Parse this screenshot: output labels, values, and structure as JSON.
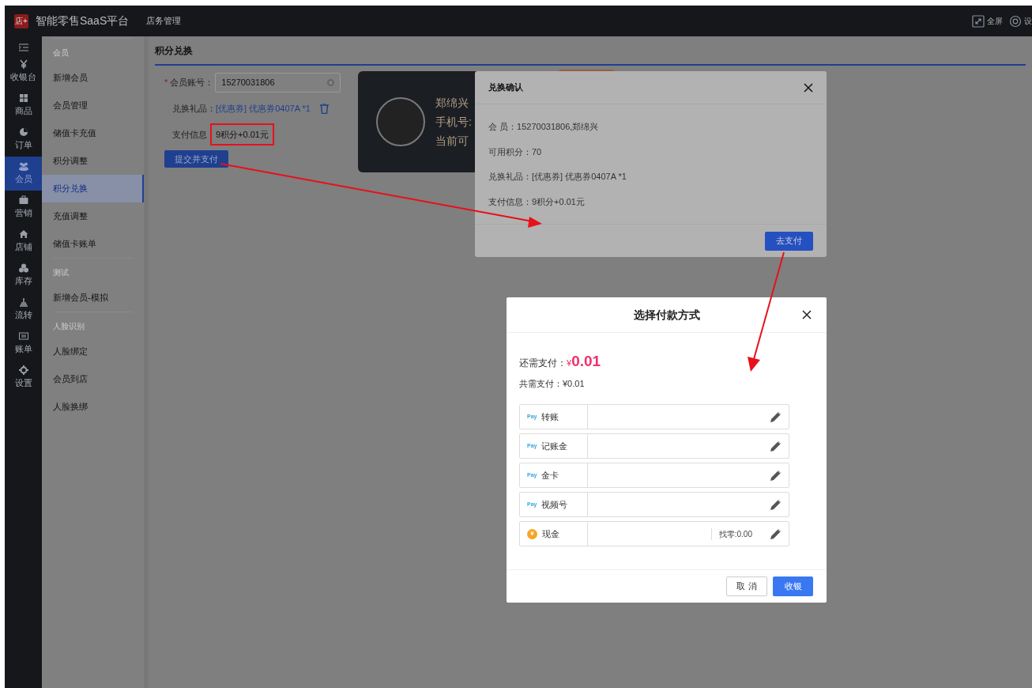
{
  "top_bar": {
    "logo": "店+",
    "title": "智能零售SaaS平台",
    "nav": "店务管理",
    "actions": [
      {
        "kind": "fullscreen",
        "label": "全屏"
      },
      {
        "kind": "settings",
        "label": "设"
      }
    ]
  },
  "icon_nav": [
    {
      "kind": "yen",
      "label": "收银台",
      "selected": false
    },
    {
      "kind": "grid",
      "label": "商品",
      "selected": false
    },
    {
      "kind": "pie",
      "label": "订单",
      "selected": false
    },
    {
      "kind": "users",
      "label": "会员",
      "selected": true
    },
    {
      "kind": "briefcase",
      "label": "营销",
      "selected": false
    },
    {
      "kind": "home",
      "label": "店铺",
      "selected": false
    },
    {
      "kind": "cubes",
      "label": "库存",
      "selected": false
    },
    {
      "kind": "stack",
      "label": "流转",
      "selected": false
    },
    {
      "kind": "card",
      "label": "账单",
      "selected": false
    },
    {
      "kind": "gear",
      "label": "设置",
      "selected": false
    }
  ],
  "sub_nav": [
    {
      "heading": "会员",
      "items": [
        {
          "label": "新增会员",
          "selected": false
        },
        {
          "label": "会员管理",
          "selected": false
        },
        {
          "label": "储值卡充值",
          "selected": false
        },
        {
          "label": "积分调整",
          "selected": false
        },
        {
          "label": "积分兑换",
          "selected": true
        },
        {
          "label": "充值调整",
          "selected": false
        },
        {
          "label": "储值卡账单",
          "selected": false
        }
      ]
    },
    {
      "heading": "测试",
      "items": [
        {
          "label": "新增会员-模拟",
          "selected": false
        }
      ]
    },
    {
      "heading": "人脸识别",
      "items": [
        {
          "label": "人脸绑定",
          "selected": false
        },
        {
          "label": "会员到店",
          "selected": false
        },
        {
          "label": "人脸换绑",
          "selected": false
        }
      ]
    }
  ],
  "page": {
    "title": "积分兑换",
    "form": {
      "required_mark": "*",
      "account_label": "会员账号：",
      "account_value": "15270031806",
      "gift_label": "兑换礼品：",
      "gift_value": "[优惠券] 优惠券0407A *1",
      "pay_label": "支付信息",
      "pay_value": "9积分+0.01元",
      "pay_highlighted": true,
      "submit": "提交并支付"
    },
    "member_card": {
      "name": "郑绵兴",
      "phone": "手机号:",
      "points": "当前可"
    }
  },
  "confirm_dialog": {
    "title": "兑换确认",
    "lines": [
      "会 员：15270031806,郑绵兴",
      "可用积分：70",
      "兑换礼品：[优惠券] 优惠券0407A *1",
      "支付信息：9积分+0.01元"
    ],
    "button": "去支付"
  },
  "payment_dialog": {
    "title": "选择付款方式",
    "due_label": "还需支付：",
    "due_currency": "¥",
    "due_amount": "0.01",
    "total": "共需支付：¥0.01",
    "methods": [
      {
        "kind": "pay",
        "badge": "Pay",
        "label": "转账"
      },
      {
        "kind": "pay",
        "badge": "Pay",
        "label": "记账金"
      },
      {
        "kind": "pay",
        "badge": "Pay",
        "label": "金卡"
      },
      {
        "kind": "pay",
        "badge": "Pay",
        "label": "视频号"
      },
      {
        "kind": "cash",
        "badge": "¥",
        "label": "现金",
        "change": "找零:0.00"
      }
    ],
    "cancel": "取 消",
    "confirm": "收银"
  }
}
